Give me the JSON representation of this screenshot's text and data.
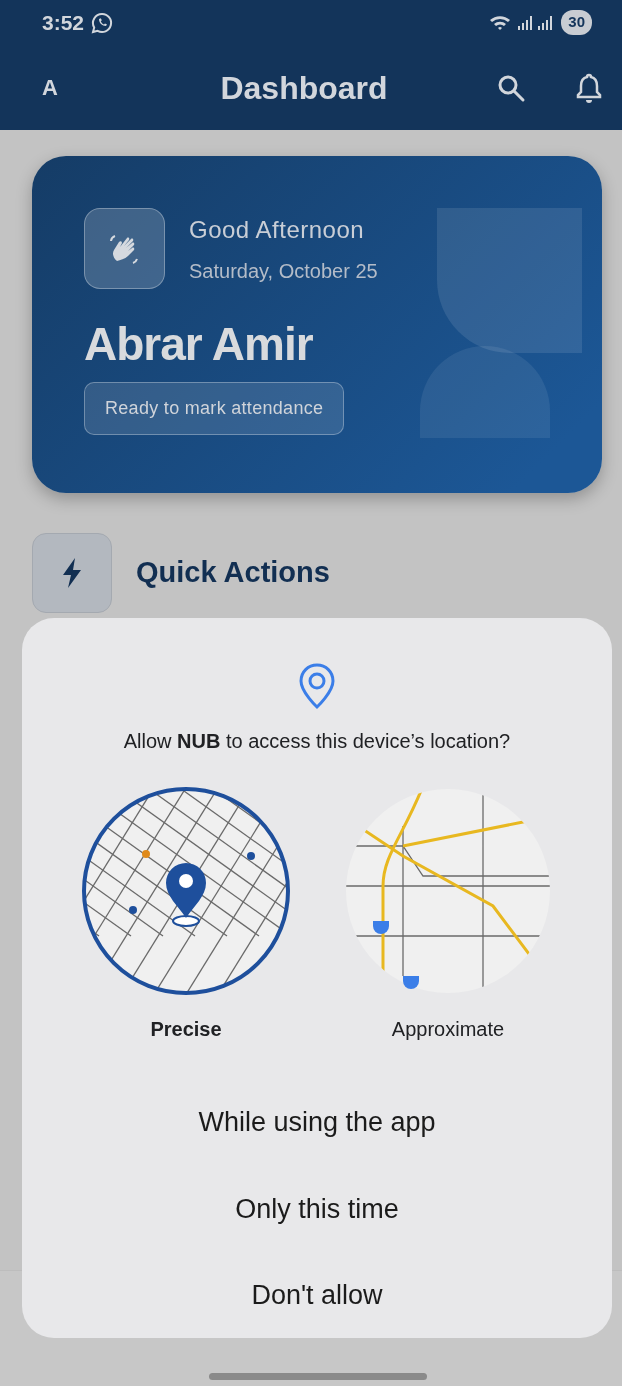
{
  "status_bar": {
    "time": "3:52",
    "battery": "30"
  },
  "app_bar": {
    "avatar": "A",
    "title": "Dashboard"
  },
  "greeting_card": {
    "greeting": "Good Afternoon",
    "date": "Saturday, October 25",
    "name": "Abrar Amir",
    "status": "Ready to mark attendance"
  },
  "section": {
    "title": "Quick Actions"
  },
  "dialog": {
    "prompt": "Allow **NUB** to access this device’s location?",
    "options": [
      {
        "kind": "precise",
        "label": "Precise",
        "selected": true
      },
      {
        "kind": "approximate",
        "label": "Approximate",
        "selected": false
      }
    ],
    "buttons": [
      "While using the app",
      "Only this time",
      "Don't allow"
    ]
  }
}
